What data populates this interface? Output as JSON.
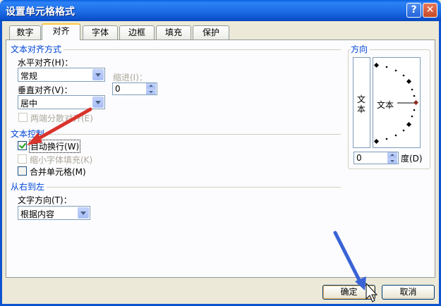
{
  "window": {
    "title": "设置单元格格式",
    "help_glyph": "?",
    "close_glyph": "✕"
  },
  "tabs": [
    {
      "label": "数字",
      "active": false
    },
    {
      "label": "对齐",
      "active": true
    },
    {
      "label": "字体",
      "active": false
    },
    {
      "label": "边框",
      "active": false
    },
    {
      "label": "填充",
      "active": false
    },
    {
      "label": "保护",
      "active": false
    }
  ],
  "text_alignment": {
    "group_label": "文本对齐方式",
    "horizontal_label": "水平对齐(H)：",
    "horizontal_value": "常规",
    "indent_label": "缩进(I)：",
    "indent_value": "0",
    "vertical_label": "垂直对齐(V)：",
    "vertical_value": "居中",
    "justify_distributed_label": "两端分散对齐(E)"
  },
  "text_control": {
    "group_label": "文本控制",
    "wrap_text_label": "自动换行(W)",
    "wrap_text_checked": true,
    "shrink_to_fit_label": "缩小字体填充(K)",
    "merge_cells_label": "合并单元格(M)"
  },
  "right_to_left": {
    "group_label": "从右到左",
    "text_direction_label": "文字方向(T)：",
    "text_direction_value": "根据内容"
  },
  "orientation": {
    "group_label": "方向",
    "vertical_text": "文本",
    "dial_text": "文本",
    "degrees_value": "0",
    "degrees_label": "度(D)"
  },
  "footer": {
    "ok_label": "确定",
    "cancel_label": "取消"
  },
  "colors": {
    "accent_red": "#d9332b",
    "accent_blue": "#3a63d6"
  }
}
